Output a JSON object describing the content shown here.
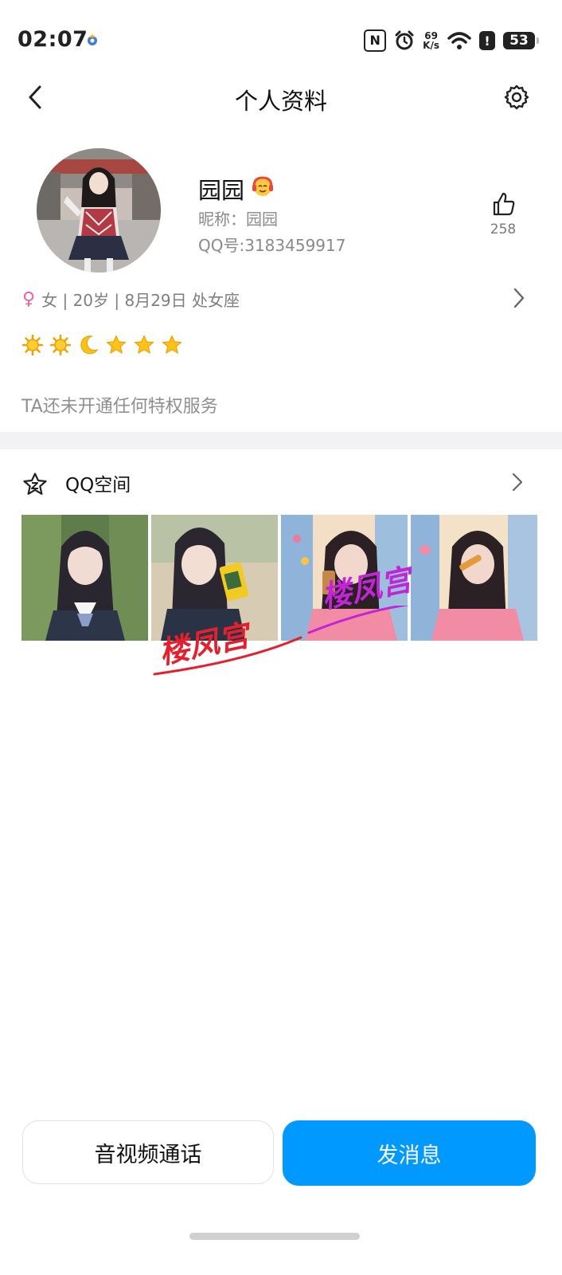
{
  "status_bar": {
    "time": "02:07",
    "network_speed_value": "69",
    "network_speed_unit": "K/s",
    "battery_level": "53",
    "icons": [
      "app-notification-icon",
      "nfc-icon",
      "alarm-icon",
      "network-speed-icon",
      "wifi-icon",
      "alert-icon",
      "battery-icon"
    ]
  },
  "header": {
    "title": "个人资料",
    "icons": [
      "back-arrow-icon",
      "settings-gear-icon"
    ]
  },
  "profile": {
    "name": "园园",
    "nickname": "昵称：园园",
    "qq_number": "QQ号:3183459917",
    "likes": "258",
    "info_line": "女 | 20岁 | 8月29日 处女座",
    "gender_icon": "female-icon",
    "level_icons": [
      "sun-icon",
      "sun-icon",
      "moon-icon",
      "star-icon",
      "star-icon",
      "star-icon"
    ],
    "privilege_text": "TA还未开通任何特权服务"
  },
  "qzone": {
    "label": "QQ空间",
    "photo_count": 4,
    "watermark": "楼凤宫"
  },
  "actions": {
    "call_label": "音视频通话",
    "message_label": "发消息"
  },
  "colors": {
    "accent": "#0099ff",
    "female": "#ee5fa7",
    "watermark_red": "#e5202e",
    "watermark_purple": "#c026d3"
  }
}
